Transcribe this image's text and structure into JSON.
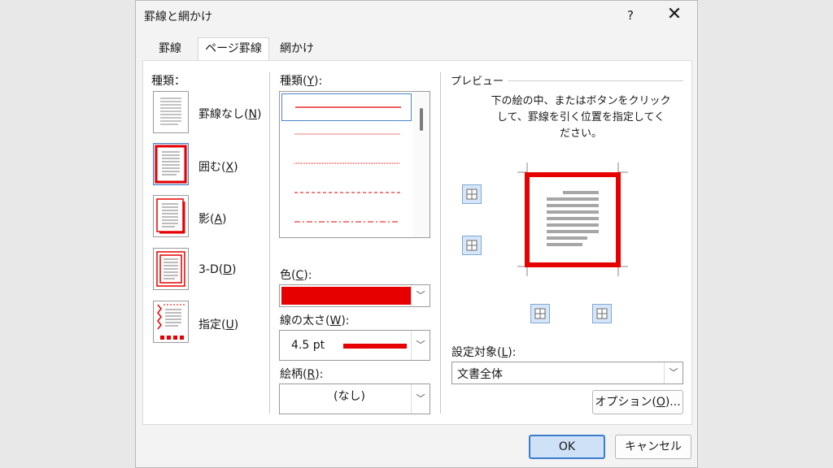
{
  "dialog": {
    "title": "罫線と網かけ",
    "help_label": "?",
    "close_label": "✕"
  },
  "tabs": [
    {
      "label": "罫線",
      "active": false
    },
    {
      "label": "ページ罫線",
      "active": true
    },
    {
      "label": "網かけ",
      "active": false
    }
  ],
  "settings": {
    "heading": "種類：",
    "items": [
      {
        "label": "罫線なし(",
        "key": "N",
        "tail": ")",
        "selected": false
      },
      {
        "label": "囲む(",
        "key": "X",
        "tail": ")",
        "selected": true
      },
      {
        "label": "影(",
        "key": "A",
        "tail": ")",
        "selected": false
      },
      {
        "label": "3-D(",
        "key": "D",
        "tail": ")",
        "selected": false
      },
      {
        "label": "指定(",
        "key": "U",
        "tail": ")",
        "selected": false
      }
    ]
  },
  "style": {
    "type_label": "種類(",
    "type_key": "Y",
    "type_tail": "):",
    "color_label": "色(",
    "color_key": "C",
    "color_tail": "):",
    "color_value": "#e60000",
    "width_label": "線の太さ(",
    "width_key": "W",
    "width_tail": "):",
    "width_value": "4.5 pt",
    "art_label": "絵柄(",
    "art_key": "R",
    "art_tail": "):",
    "art_value": "(なし)",
    "line_color": "#e60000"
  },
  "preview": {
    "heading": "プレビュー",
    "instructions": [
      "下の絵の中、またはボタンをクリック",
      "して、罫線を引く位置を指定してく",
      "ださい。"
    ],
    "apply_label": "設定対象(",
    "apply_key": "L",
    "apply_tail": "):",
    "apply_value": "文書全体",
    "options_label": "オプション(",
    "options_key": "O",
    "options_tail": ")..."
  },
  "footer": {
    "ok_label": "OK",
    "cancel_label": "キャンセル"
  }
}
